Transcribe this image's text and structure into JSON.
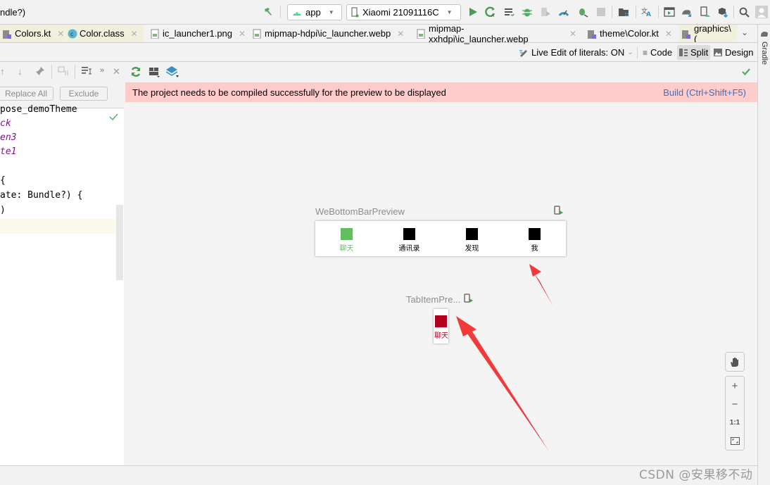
{
  "topbar": {
    "title_fragment": "ndle?)",
    "run_config": "app",
    "device": "Xiaomi 21091116C",
    "icons": [
      "hammer-icon",
      "run-icon",
      "apply-changes-icon",
      "apply-code-changes-icon",
      "debug-icon",
      "attach-debugger-icon",
      "profile-icon",
      "debug-attach-icon",
      "stop-icon",
      "project-structure-icon",
      "translate-icon",
      "layout-inspector-icon",
      "gradle-sync-icon",
      "device-manager-icon",
      "sdk-manager-icon",
      "search-icon",
      "avatar-icon"
    ]
  },
  "tabs": [
    {
      "label": "Colors.kt",
      "icon": "kotlin-file-icon",
      "highlighted": true
    },
    {
      "label": "Color.class",
      "icon": "class-file-icon",
      "highlighted": true
    },
    {
      "label": "ic_launcher1.png",
      "icon": "image-file-icon"
    },
    {
      "label": "mipmap-hdpi\\ic_launcher.webp",
      "icon": "image-file-icon"
    },
    {
      "label": "mipmap-xxhdpi\\ic_launcher.webp",
      "icon": "image-file-icon"
    },
    {
      "label": "theme\\Color.kt",
      "icon": "kotlin-file-icon"
    },
    {
      "label": "graphics\\(",
      "icon": "kotlin-file-icon",
      "highlighted": true
    }
  ],
  "modes": {
    "live_edit": "Live Edit of literals: ON",
    "code": "Code",
    "split": "Split",
    "design": "Design",
    "active": "Split"
  },
  "right_strip": {
    "label": "Gradle"
  },
  "find": {
    "replace_all": "Replace All",
    "exclude": "Exclude"
  },
  "editor": {
    "lines": [
      {
        "text": "pose_demoTheme",
        "kind": "plain"
      },
      {
        "text": "ck",
        "kind": "kw"
      },
      {
        "text": "en3",
        "kind": "kw"
      },
      {
        "text": "te1",
        "kind": "kw"
      },
      {
        "text": "",
        "kind": "plain"
      },
      {
        "text": "{",
        "kind": "plain"
      },
      {
        "text": "ate: Bundle?) {",
        "kind": "plain"
      },
      {
        "text": ")",
        "kind": "plain"
      }
    ]
  },
  "preview": {
    "banner_message": "The project needs to be compiled successfully for the preview to be displayed",
    "banner_action": "Build (Ctrl+Shift+F5)",
    "bottom_bar_preview": {
      "title": "WeBottomBarPreview",
      "items": [
        {
          "label": "聊天",
          "color": "#64be5f",
          "selected": true
        },
        {
          "label": "通讯录",
          "color": "#000000",
          "selected": false
        },
        {
          "label": "发现",
          "color": "#000000",
          "selected": false
        },
        {
          "label": "我",
          "color": "#000000",
          "selected": false
        }
      ]
    },
    "tab_item_preview": {
      "title": "TabItemPre...",
      "item": {
        "label": "聊天",
        "color": "#b0001e"
      }
    },
    "zoom_controls": {
      "pan": "pan-hand-icon",
      "zoom_in": "+",
      "zoom_out": "−",
      "actual_size": "1:1",
      "fit": "fit-screen-icon"
    }
  },
  "watermark": "CSDN @安果移不动",
  "colors": {
    "banner_bg": "#ffcccc",
    "link": "#3e6fb7",
    "accent_green": "#59a869",
    "arrow_red": "#f23a3a"
  }
}
